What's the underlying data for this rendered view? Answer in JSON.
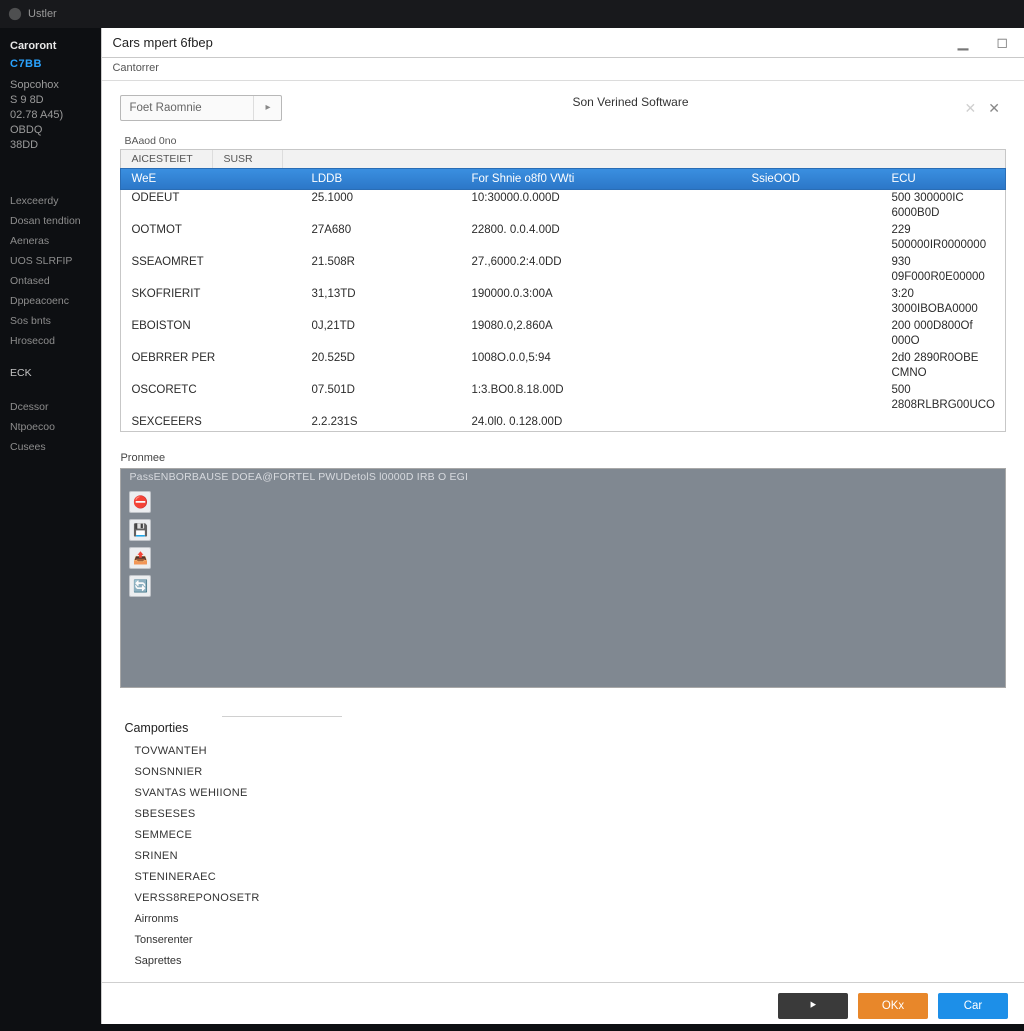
{
  "titlebar": {
    "label": "Ustler"
  },
  "sidebar": {
    "heading": "Caroront",
    "active": "C7BB",
    "info": [
      "Sopcohox",
      "S 9 8D",
      "02.78 A45)",
      "OBDQ",
      "38DD"
    ],
    "nav": [
      "Lexceerdy",
      "Dosan tendtion",
      "Aeneras",
      "UOS SLRFIP",
      "Ontased",
      "Dppeacoenc",
      "Sos bnts",
      "Hrosecod"
    ],
    "key": "ECK",
    "nav2": [
      "Dcessor",
      "Ntpoecoo",
      "Cusees"
    ]
  },
  "window": {
    "title": "Cars mpert 6fbep",
    "subtitle": "Cantorrer",
    "filter": "Foet Raomnie",
    "section_right": "Son Verined Software"
  },
  "grid": {
    "label": "BAaod 0no",
    "tabs": [
      "AICESTEIET",
      "SUSR"
    ],
    "columns": [
      "WeE",
      "LDDB",
      "For Shnie o8f0 VWti",
      "SsieOOD",
      "ECU"
    ],
    "rows": [
      {
        "c0": "ODEEUT",
        "c1": "25.1000",
        "c2": "10:30000.0.000D",
        "c3": "",
        "c4": "500 300000IC 6000B0D"
      },
      {
        "c0": "OOTMOT",
        "c1": "27A680",
        "c2": "22800. 0.0.4.00D",
        "c3": "",
        "c4": "229 500000IR0000000"
      },
      {
        "c0": "SSEAOMRET",
        "c1": "21.508R",
        "c2": "27.,6000.2:4.0DD",
        "c3": "",
        "c4": "930 09F000R0E00000"
      },
      {
        "c0": "SKOFRIERIT",
        "c1": "31,13TD",
        "c2": "190000.0.3:00A",
        "c3": "",
        "c4": "3:20 3000IBOBA0000"
      },
      {
        "c0": "EBOISTON",
        "c1": "0J,21TD",
        "c2": "19080.0,2.860A",
        "c3": "",
        "c4": "200 000D800Of 000O"
      },
      {
        "c0": "OEBRRER PER",
        "c1": "20.525D",
        "c2": "1008O.0.0,5:94",
        "c3": "",
        "c4": "2d0 2890R0OBE CMNO"
      },
      {
        "c0": "OSCORETC",
        "c1": "07.501D",
        "c2": "1:3.BO0.8.18.00D",
        "c3": "",
        "c4": "500 2808RLBRG00UCO"
      },
      {
        "c0": "SEXCEEERS",
        "c1": "2.2.231S",
        "c2": "24.0l0. 0.128.00D",
        "c3": "",
        "c4": ""
      }
    ]
  },
  "preview": {
    "label": "Pronmee",
    "path": "PassENBORBAUSE DOEA@FORTEL PWUDetolS l0000D IRB O EGI",
    "icons": [
      "stop-icon",
      "save-icon",
      "export-icon",
      "refresh-icon"
    ],
    "glyphs": [
      "⛔",
      "💾",
      "📤",
      "🔄"
    ]
  },
  "properties": {
    "title": "Camporties",
    "items": [
      "TovWanteh",
      "Sonsnnier",
      "Svantas Wehiione",
      "Sbeseses",
      "Semmece",
      "Srinen",
      "Stenineraec",
      "Verss8reponosetr",
      "Airronms",
      "Tonserenter",
      "Saprettes"
    ],
    "normal_idx": {
      "8": true,
      "9": true,
      "10": true
    }
  },
  "footer": {
    "back": "⯈",
    "ok": "OKx",
    "cancel": "Car"
  },
  "icons": {
    "min": "▁",
    "max": "◻",
    "close": "✕",
    "arrow_r": "▸",
    "soft_x": "✕"
  }
}
